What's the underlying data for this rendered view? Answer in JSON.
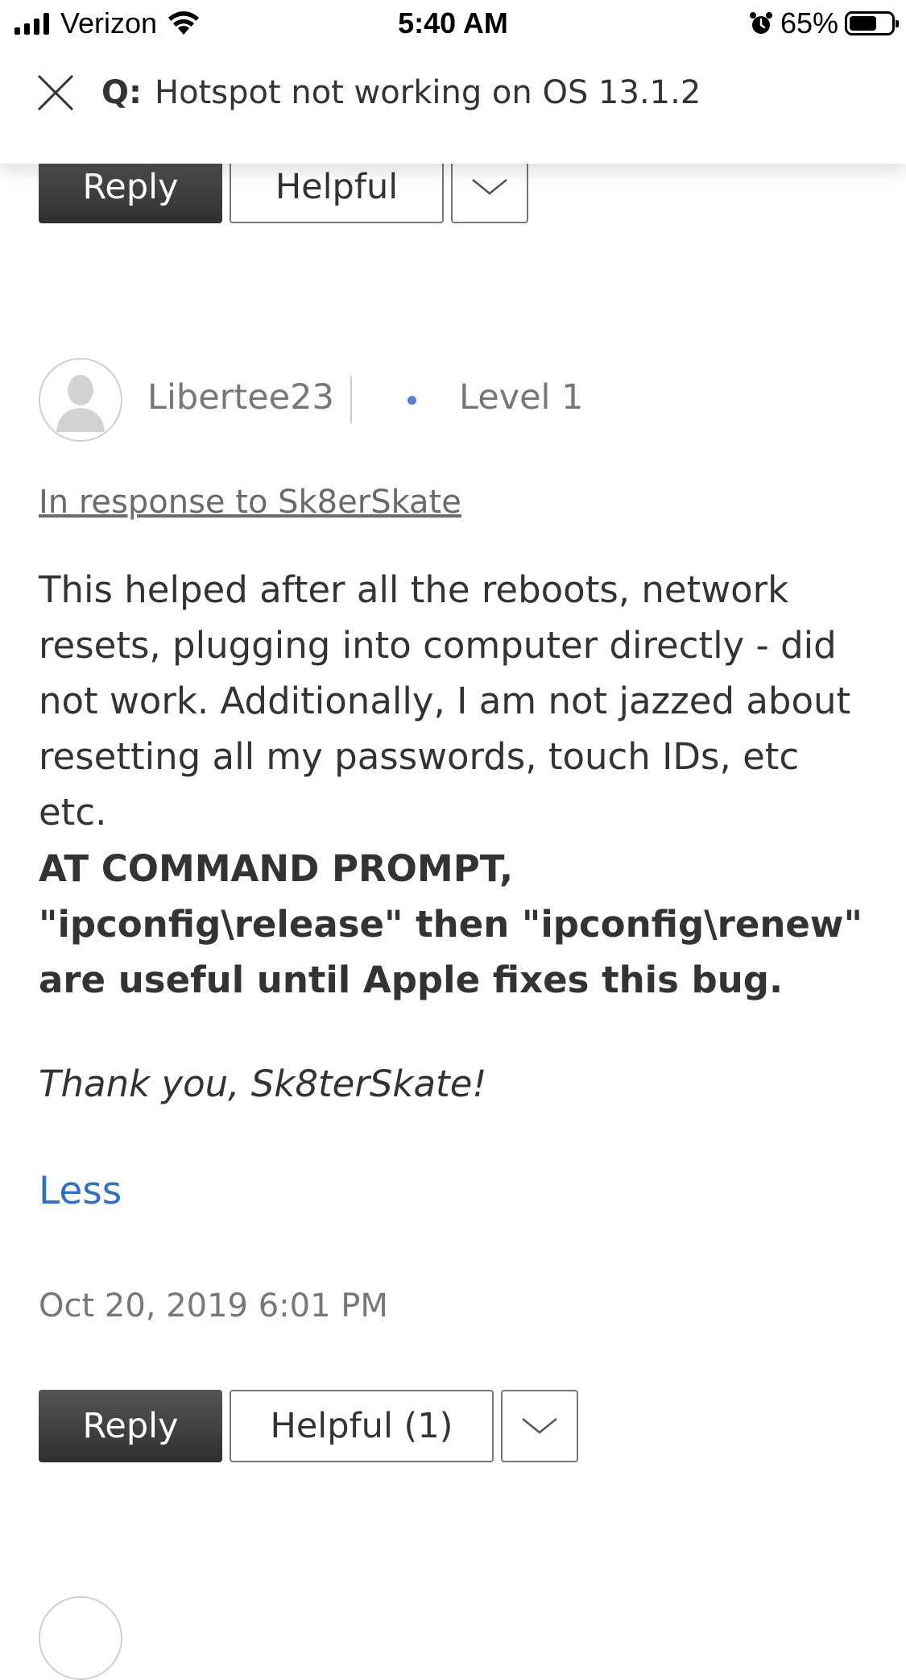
{
  "status_bar": {
    "carrier": "Verizon",
    "time": "5:40 AM",
    "battery_percent": "65%",
    "battery_level": 0.65
  },
  "header": {
    "question_prefix": "Q:",
    "question_title": "Hotspot not working on OS 13.1.2"
  },
  "prev_actions": {
    "reply_label": "Reply",
    "helpful_label": "Helpful"
  },
  "post": {
    "username": "Libertee23",
    "level": "Level 1",
    "in_response_to": "In response to Sk8erSkate",
    "body": "This helped after all the reboots, network resets, plugging into computer directly - did not work.  Additionally, I am not jazzed about resetting all my passwords, touch IDs, etc etc.",
    "bold_body": "AT COMMAND PROMPT, \"ipconfig\\release\" then \"ipconfig\\renew\"  are useful until Apple fixes this bug.",
    "italic_body": "Thank you, Sk8terSkate!",
    "less_label": "Less",
    "timestamp": "Oct 20, 2019 6:01 PM"
  },
  "post_actions": {
    "reply_label": "Reply",
    "helpful_label": "Helpful (1)"
  },
  "colors": {
    "link_blue": "#2f70c4",
    "level_dot": "#5b7fd0",
    "button_dark": "#3a3a3a"
  }
}
